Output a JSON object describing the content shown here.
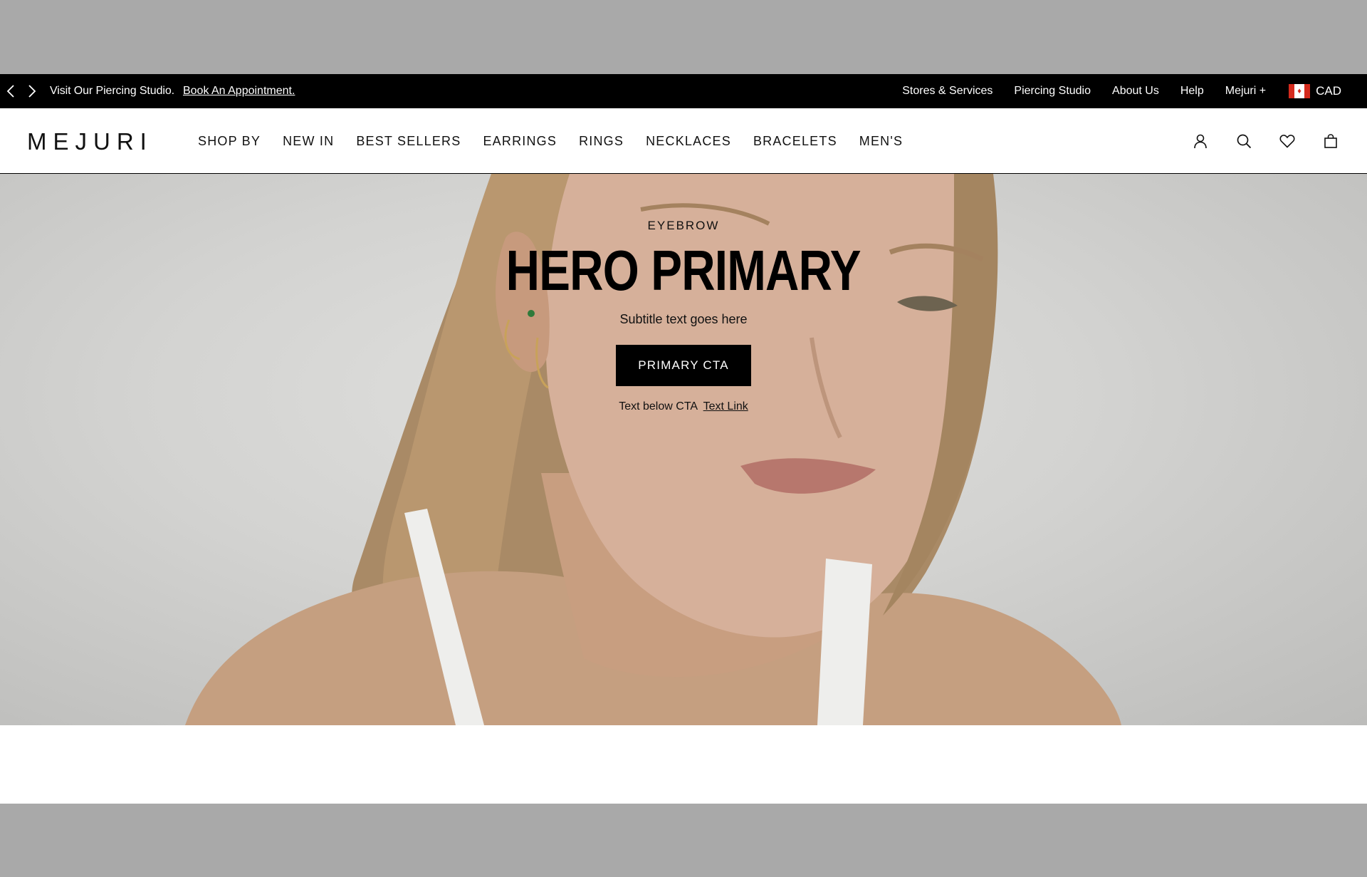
{
  "announcement": {
    "prev_icon": "chevron-left-icon",
    "next_icon": "chevron-right-icon",
    "text": "Visit Our Piercing Studio.",
    "link": "Book An Appointment.",
    "utility_links": [
      "Stores & Services",
      "Piercing Studio",
      "About Us",
      "Help",
      "Mejuri +"
    ],
    "currency": "CAD",
    "flag_icon": "canada-flag-icon"
  },
  "nav": {
    "logo": "MEJURI",
    "links": [
      "SHOP BY",
      "NEW IN",
      "BEST SELLERS",
      "EARRINGS",
      "RINGS",
      "NECKLACES",
      "BRACELETS",
      "MEN'S"
    ],
    "icons": [
      "account-icon",
      "search-icon",
      "wishlist-heart-icon",
      "shopping-bag-icon"
    ]
  },
  "hero": {
    "eyebrow": "EYEBROW",
    "title": "HERO PRIMARY",
    "subtitle": "Subtitle text goes here",
    "cta": "PRIMARY CTA",
    "below_cta_text": "Text below CTA",
    "below_cta_link": "Text Link"
  },
  "colors": {
    "announcement_bg": "#000000",
    "cta_bg": "#000000",
    "page_margin": "#a9a9a9"
  }
}
